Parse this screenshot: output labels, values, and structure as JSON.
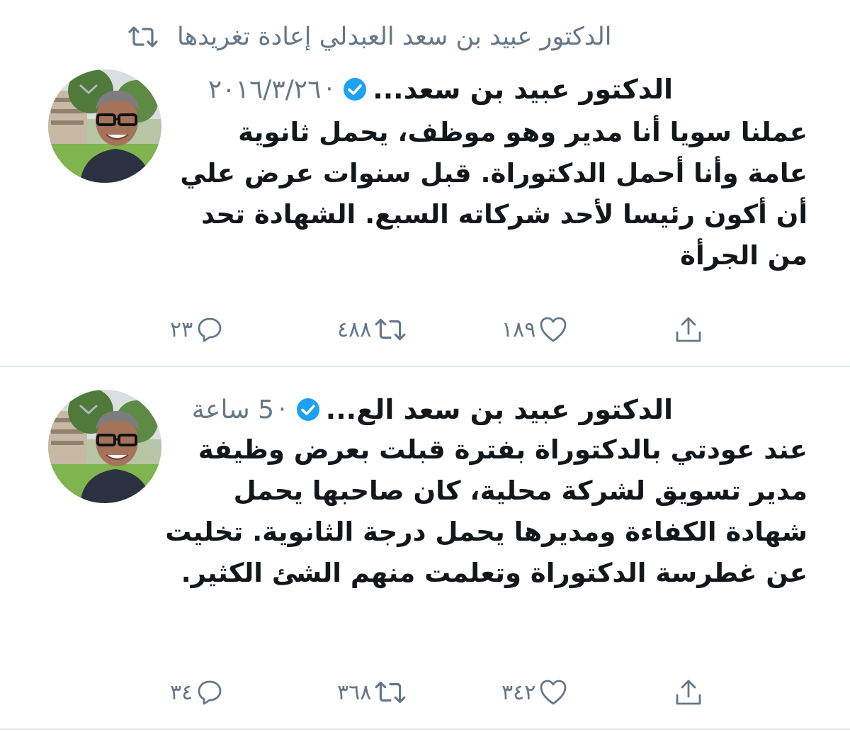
{
  "retweet_header": {
    "text": "الدكتور عبيد بن سعد العبدلي إعادة تغريدها",
    "icon": "retweet-icon"
  },
  "tweets": [
    {
      "author": "الدكتور عبيد بن سعد...",
      "verified_icon": "verified-badge-icon",
      "separator": "·",
      "time": "٢٠١٦/٣/٢٦",
      "body": "عملنا سويا أنا مدير وهو موظف، يحمل ثانوية عامة وأنا أحمل الدكتوراة. قبل سنوات عرض علي أن أكون رئيسا لأحد شركاته السبع. الشهادة تحد من الجرأة",
      "replies": "٢٣",
      "retweets": "٤٨٨",
      "likes": "١٨٩"
    },
    {
      "author": "الدكتور عبيد بن سعد الع...",
      "verified_icon": "verified-badge-icon",
      "separator": "·",
      "time": "5 ساعة",
      "body": "عند عودتي بالدكتوراة بفترة قبلت بعرض وظيفة مدير تسويق لشركة محلية، كان صاحبها يحمل شهادة الكفاءة ومديرها يحمل درجة الثانوية. تخليت عن غطرسة الدكتوراة وتعلمت منهم الشئ الكثير.",
      "replies": "٣٤",
      "retweets": "٣٦٨",
      "likes": "٣٤٢"
    }
  ],
  "colors": {
    "text_primary": "#14171a",
    "text_secondary": "#657786",
    "verified_blue": "#1da1f2",
    "divider": "#e1e8ed"
  }
}
